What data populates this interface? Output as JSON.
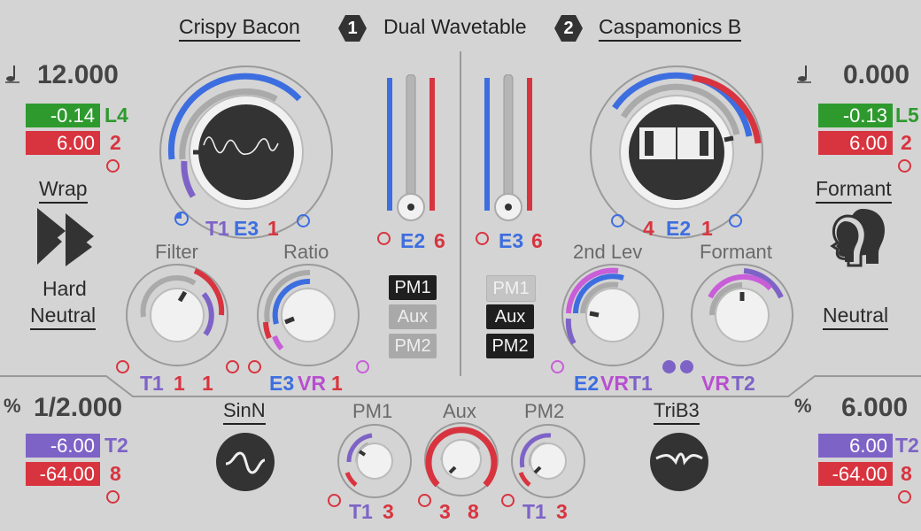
{
  "header": {
    "left_name": "Crispy Bacon",
    "badge1": "1",
    "title": "Dual Wavetable",
    "badge2": "2",
    "right_name": "Caspamonics B"
  },
  "left_panel": {
    "note_value": "12.000",
    "green_value": "-0.14",
    "green_tag": "L4",
    "red_value": "6.00",
    "red_tag": "2",
    "mode_label": "Wrap",
    "warp_label": "Hard",
    "neutral_label": "Neutral"
  },
  "right_panel": {
    "note_value": "0.000",
    "green_value": "-0.13",
    "green_tag": "L5",
    "red_value": "6.00",
    "red_tag": "2",
    "mode_label": "Formant",
    "neutral_label": "Neutral"
  },
  "osc1": {
    "mod_t1": "T1",
    "mod_e3": "E3",
    "mod_1": "1",
    "filter_label": "Filter",
    "ratio_label": "Ratio",
    "filter_mods": [
      "T1",
      "1",
      "1"
    ],
    "ratio_mods": [
      "E3",
      "VR",
      "1"
    ]
  },
  "osc2": {
    "mod_4": "4",
    "mod_e2": "E2",
    "mod_1": "1",
    "lev_label": "2nd Lev",
    "formant_label": "Formant",
    "lev_mods": [
      "E2",
      "VR",
      "T1"
    ],
    "formant_mods": [
      "VR",
      "T2"
    ]
  },
  "faders": {
    "left_mod": "E2",
    "left_num": "6",
    "right_mod": "E3",
    "right_num": "6"
  },
  "routing_left": [
    "PM1",
    "Aux",
    "PM2"
  ],
  "routing_right": [
    "PM1",
    "Aux",
    "PM2"
  ],
  "bottom_left": {
    "ratio_value": "1/2.000",
    "purple_value": "-6.00",
    "purple_tag": "T2",
    "red_value": "-64.00",
    "red_tag": "8",
    "shape_label": "SinN"
  },
  "bottom_right": {
    "ratio_value": "6.000",
    "purple_value": "6.00",
    "purple_tag": "T2",
    "red_value": "-64.00",
    "red_tag": "8",
    "shape_label": "TriB3"
  },
  "bottom_knobs": {
    "pm1_label": "PM1",
    "aux_label": "Aux",
    "pm2_label": "PM2",
    "pm1_mods": [
      "T1",
      "3"
    ],
    "aux_mods": [
      "3",
      "8"
    ],
    "pm2_mods": [
      "T1",
      "3"
    ]
  },
  "colors": {
    "green": "#2e9a2e",
    "red": "#d8343f",
    "blue": "#3d6ee0",
    "purple": "#7e63c7",
    "magenta": "#c85ed8"
  }
}
